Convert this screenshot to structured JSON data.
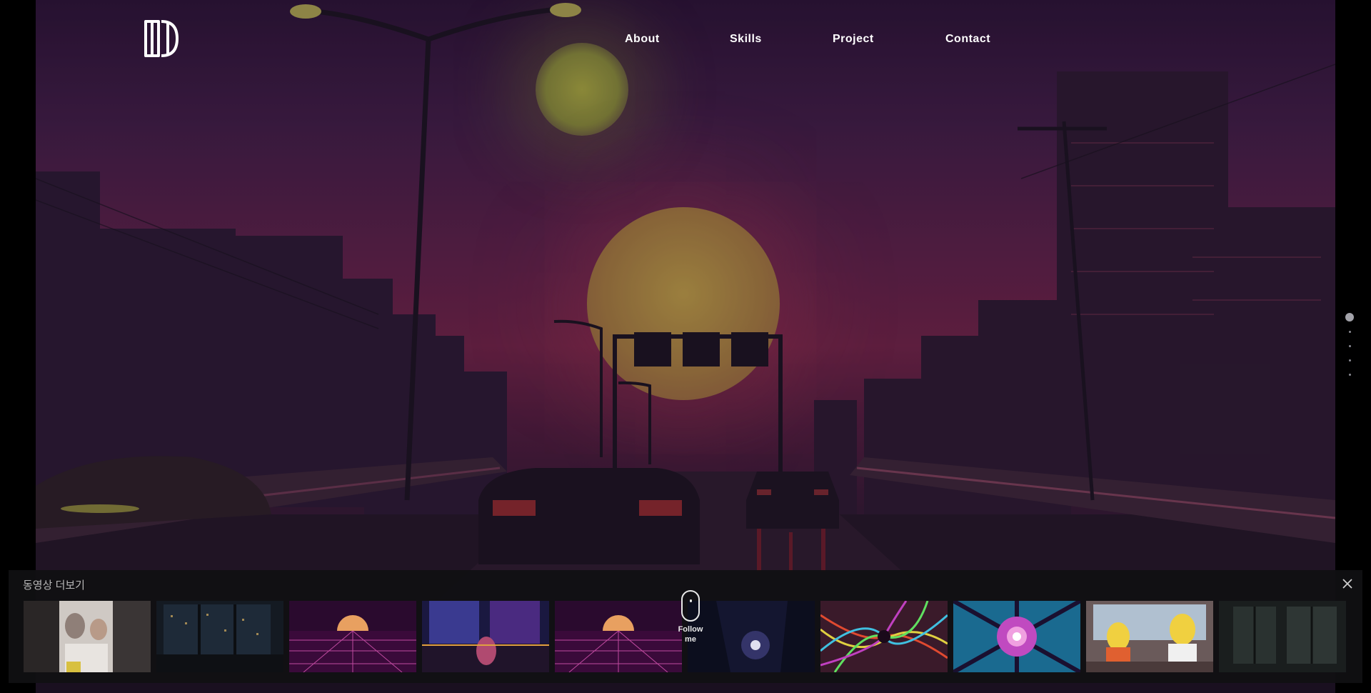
{
  "nav": {
    "items": [
      {
        "label": "About"
      },
      {
        "label": "Skills"
      },
      {
        "label": "Project"
      },
      {
        "label": "Contact"
      }
    ]
  },
  "hero": {
    "background_colors": {
      "sky_top": "#2a1435",
      "sky_mid": "#6d2446",
      "ground": "#241a2c",
      "sun": "#b89a46"
    },
    "section_indicator": {
      "count": 5,
      "active_index": 0
    }
  },
  "scroll_hint": {
    "label": "Follow\nme"
  },
  "video_panel": {
    "title": "동영상 더보기",
    "close_icon": "close-icon",
    "thumbnails": [
      {
        "theme": "family-photo"
      },
      {
        "theme": "night-city-window"
      },
      {
        "theme": "synthwave-grid"
      },
      {
        "theme": "neon-room"
      },
      {
        "theme": "synthwave-grid"
      },
      {
        "theme": "blue-moon-night"
      },
      {
        "theme": "psychedelic-swirl"
      },
      {
        "theme": "kaleidoscope"
      },
      {
        "theme": "cartoon-car"
      },
      {
        "theme": "dark-window-rain"
      }
    ]
  }
}
